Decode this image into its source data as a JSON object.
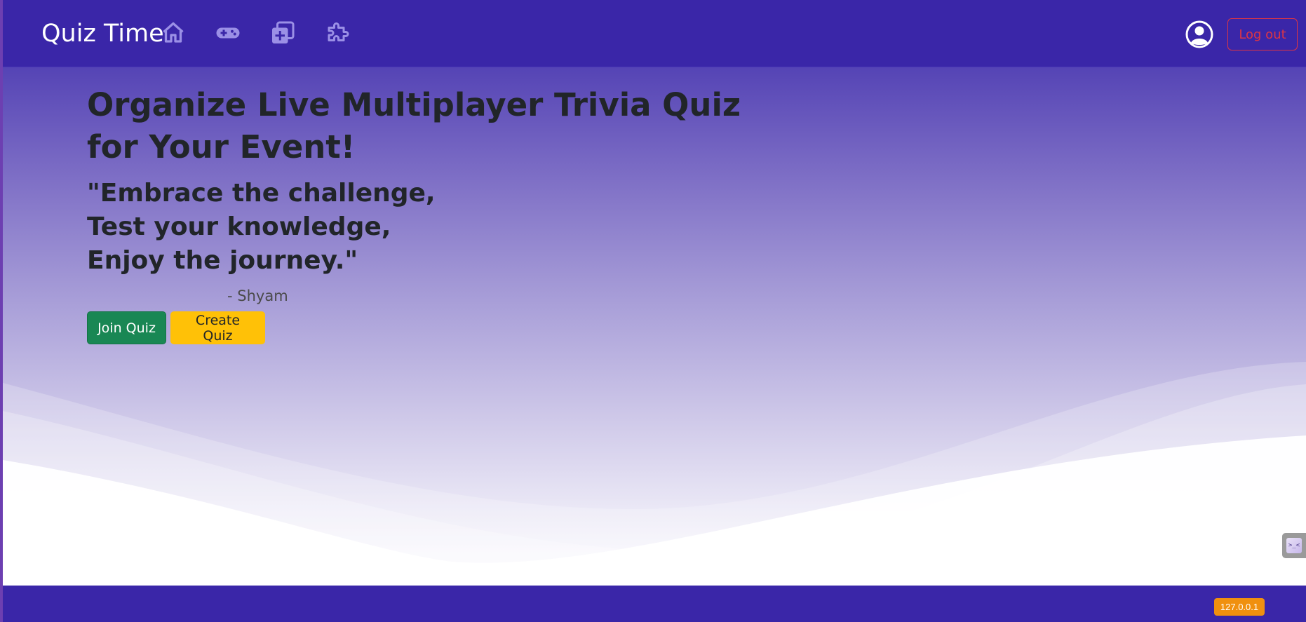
{
  "navbar": {
    "brand": "Quiz Time",
    "icons": [
      "home-icon",
      "gamepad-icon",
      "add-quiz-icon",
      "puzzle-icon"
    ],
    "logout_label": "Log out",
    "background": "#3a26a8"
  },
  "hero": {
    "headline": "Organize Live Multiplayer Trivia Quiz for Your Event!",
    "quote_lines": [
      "\"Embrace the challenge,",
      "Test your knowledge,",
      "Enjoy the journey.\""
    ],
    "author": "- Shyam",
    "join_label": "Join Quiz",
    "create_label": "Create Quiz"
  },
  "footer": {
    "host_badge": "127.0.0.1"
  },
  "colors": {
    "accent": "#3a26a8",
    "join": "#198754",
    "create": "#ffc107",
    "logout": "#dc3545",
    "badge": "#f0900f"
  }
}
